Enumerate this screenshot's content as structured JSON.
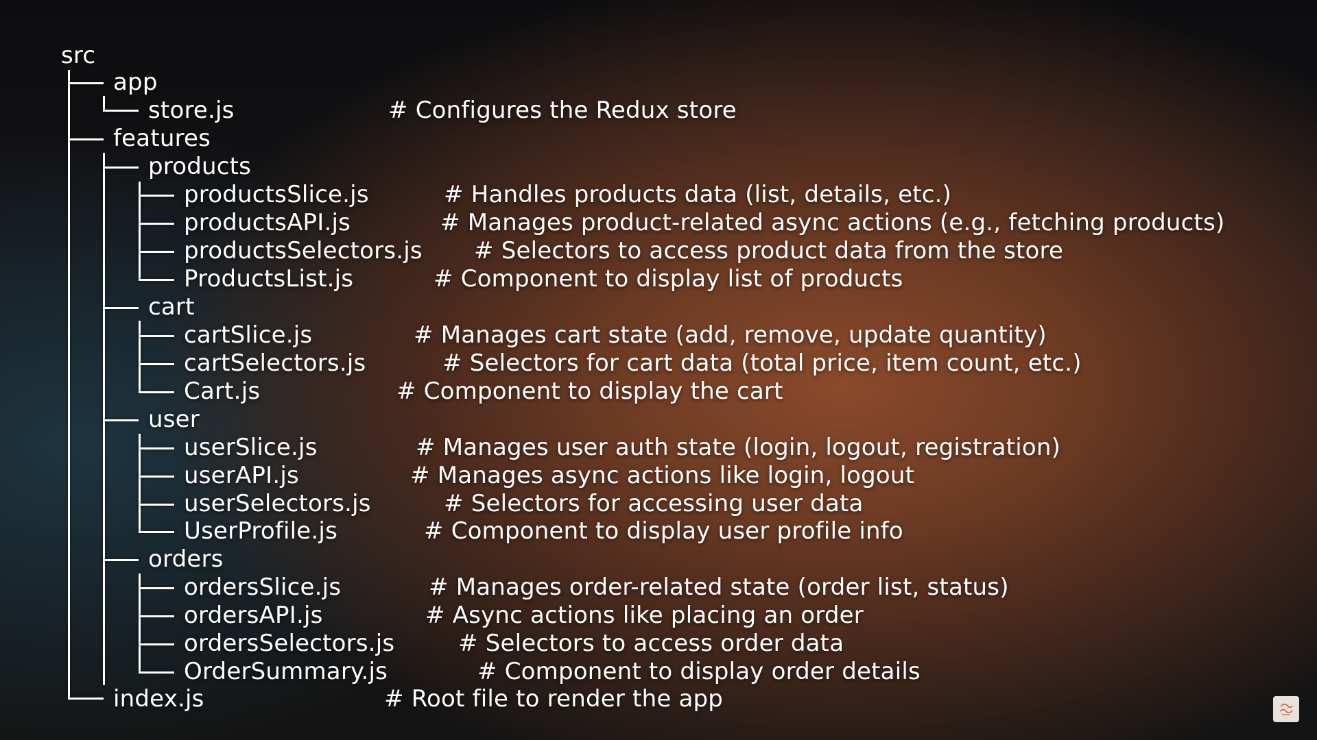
{
  "tree": {
    "rows": [
      {
        "label": "src",
        "comment": ""
      },
      {
        "label": "app",
        "comment": ""
      },
      {
        "label": "store.js",
        "comment": "# Configures the Redux store"
      },
      {
        "label": "features",
        "comment": ""
      },
      {
        "label": "products",
        "comment": ""
      },
      {
        "label": "productsSlice.js",
        "comment": "# Handles products data (list, details, etc.)"
      },
      {
        "label": "productsAPI.js",
        "comment": "# Manages product-related async actions (e.g., fetching products)"
      },
      {
        "label": "productsSelectors.js",
        "comment": "# Selectors to access product data from the store"
      },
      {
        "label": "ProductsList.js",
        "comment": "# Component to display list of products"
      },
      {
        "label": "cart",
        "comment": ""
      },
      {
        "label": "cartSlice.js",
        "comment": "# Manages cart state (add, remove, update quantity)"
      },
      {
        "label": "cartSelectors.js",
        "comment": "# Selectors for cart data (total price, item count, etc.)"
      },
      {
        "label": "Cart.js",
        "comment": "# Component to display the cart"
      },
      {
        "label": "user",
        "comment": ""
      },
      {
        "label": "userSlice.js",
        "comment": "# Manages user auth state (login, logout, registration)"
      },
      {
        "label": "userAPI.js",
        "comment": "# Manages async actions like login, logout"
      },
      {
        "label": "userSelectors.js",
        "comment": "# Selectors for accessing user data"
      },
      {
        "label": "UserProfile.js",
        "comment": "# Component to display user profile info"
      },
      {
        "label": "orders",
        "comment": ""
      },
      {
        "label": "ordersSlice.js",
        "comment": "# Manages order-related state (order list, status)"
      },
      {
        "label": "ordersAPI.js",
        "comment": "# Async actions like placing an order"
      },
      {
        "label": "ordersSelectors.js",
        "comment": "# Selectors to access order data"
      },
      {
        "label": "OrderSummary.js",
        "comment": "# Component to display order details"
      },
      {
        "label": "index.js",
        "comment": "# Root file to render the app"
      }
    ]
  },
  "logo": {
    "icon": "channel-logo-icon"
  }
}
